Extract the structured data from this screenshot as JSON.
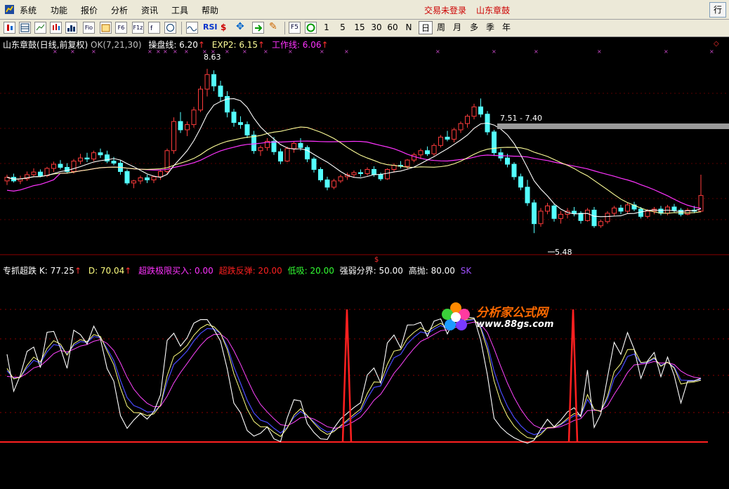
{
  "menu": [
    "系统",
    "功能",
    "报价",
    "分析",
    "资讯",
    "工具",
    "帮助"
  ],
  "status_links": {
    "trade": "交易未登录",
    "stock": "山东章鼓"
  },
  "row_button": "行",
  "toolbar": {
    "icons": [
      "Fio",
      "F10",
      "F6",
      "F1z",
      "RSI"
    ],
    "periods": [
      "1",
      "5",
      "15",
      "30",
      "60",
      "N"
    ],
    "scales": [
      "日",
      "周",
      "月",
      "多",
      "季",
      "年"
    ],
    "f5": "F5"
  },
  "main_header": {
    "name": "山东章鼓(日线,前复权)",
    "ok": "OK(7,21,30)",
    "ma1_label": "操盘线: 6.20",
    "ma2_label": "EXP2: 6.15",
    "ma3_label": "工作线: 6.06"
  },
  "annotations": {
    "high": "8.63",
    "mid": "7.51 - 7.40",
    "low": "5.48"
  },
  "indicator": {
    "name": "专抓超跌",
    "k": "K: 77.25",
    "d": "D: 70.04",
    "oversold": "超跌极限买入: 0.00",
    "rebound": "超跌反弹: 20.00",
    "low": "低吸: 20.00",
    "strong": "强弱分界: 50.00",
    "high": "高抛: 80.00",
    "sk": "SK"
  },
  "watermark": {
    "title": "分析家公式网",
    "url": "www.88gs.com"
  },
  "colors": {
    "up": "#ff3b3b",
    "down": "#54ffff",
    "ma1": "#ffffff",
    "ma2": "#ffff99",
    "ma3": "#ff33ff",
    "k": "#ffffff",
    "d": "#ffff80",
    "j": "#5050ff",
    "signal": "#ff2020"
  },
  "chart_data": {
    "type": "candlestick",
    "price_range": [
      5.2,
      8.9
    ],
    "candles": [
      [
        6.48,
        6.6,
        6.4,
        6.55
      ],
      [
        6.55,
        6.62,
        6.45,
        6.48
      ],
      [
        6.48,
        6.58,
        6.42,
        6.52
      ],
      [
        6.52,
        6.66,
        6.48,
        6.6
      ],
      [
        6.6,
        6.72,
        6.55,
        6.65
      ],
      [
        6.65,
        6.7,
        6.55,
        6.58
      ],
      [
        6.58,
        6.75,
        6.55,
        6.72
      ],
      [
        6.72,
        6.85,
        6.65,
        6.8
      ],
      [
        6.8,
        6.88,
        6.7,
        6.74
      ],
      [
        6.74,
        6.82,
        6.62,
        6.66
      ],
      [
        6.66,
        6.9,
        6.62,
        6.86
      ],
      [
        6.86,
        7.0,
        6.8,
        6.92
      ],
      [
        6.92,
        7.02,
        6.84,
        6.9
      ],
      [
        6.9,
        7.06,
        6.86,
        7.02
      ],
      [
        7.02,
        7.1,
        6.92,
        6.98
      ],
      [
        6.98,
        7.06,
        6.82,
        6.86
      ],
      [
        6.86,
        6.94,
        6.78,
        6.82
      ],
      [
        6.82,
        6.88,
        6.6,
        6.66
      ],
      [
        6.66,
        6.7,
        6.4,
        6.44
      ],
      [
        6.44,
        6.5,
        6.34,
        6.48
      ],
      [
        6.48,
        6.58,
        6.42,
        6.54
      ],
      [
        6.54,
        6.6,
        6.44,
        6.5
      ],
      [
        6.5,
        6.58,
        6.44,
        6.56
      ],
      [
        6.56,
        6.7,
        6.5,
        6.66
      ],
      [
        6.66,
        7.1,
        6.6,
        7.06
      ],
      [
        7.06,
        7.7,
        7.0,
        7.62
      ],
      [
        7.62,
        7.8,
        7.4,
        7.46
      ],
      [
        7.46,
        7.62,
        7.34,
        7.56
      ],
      [
        7.56,
        7.9,
        7.5,
        7.84
      ],
      [
        7.84,
        8.3,
        7.8,
        8.24
      ],
      [
        8.24,
        8.63,
        8.1,
        8.52
      ],
      [
        8.52,
        8.6,
        8.2,
        8.3
      ],
      [
        8.3,
        8.4,
        8.0,
        8.1
      ],
      [
        8.1,
        8.2,
        7.7,
        7.8
      ],
      [
        7.8,
        7.86,
        7.52,
        7.6
      ],
      [
        7.6,
        7.72,
        7.48,
        7.56
      ],
      [
        7.56,
        7.62,
        7.3,
        7.36
      ],
      [
        7.36,
        7.44,
        7.0,
        7.06
      ],
      [
        7.06,
        7.16,
        6.96,
        7.12
      ],
      [
        7.12,
        7.3,
        7.06,
        7.24
      ],
      [
        7.24,
        7.32,
        6.98,
        7.04
      ],
      [
        7.04,
        7.1,
        6.8,
        6.86
      ],
      [
        6.86,
        7.14,
        6.84,
        7.1
      ],
      [
        7.1,
        7.24,
        7.02,
        7.2
      ],
      [
        7.2,
        7.3,
        7.06,
        7.12
      ],
      [
        7.12,
        7.16,
        6.84,
        6.9
      ],
      [
        6.9,
        6.94,
        6.64,
        6.7
      ],
      [
        6.7,
        6.74,
        6.46,
        6.5
      ],
      [
        6.5,
        6.56,
        6.3,
        6.36
      ],
      [
        6.36,
        6.52,
        6.32,
        6.48
      ],
      [
        6.48,
        6.6,
        6.44,
        6.56
      ],
      [
        6.56,
        6.64,
        6.5,
        6.6
      ],
      [
        6.6,
        6.68,
        6.54,
        6.64
      ],
      [
        6.64,
        6.7,
        6.56,
        6.62
      ],
      [
        6.62,
        6.74,
        6.58,
        6.7
      ],
      [
        6.7,
        6.76,
        6.56,
        6.6
      ],
      [
        6.6,
        6.64,
        6.48,
        6.52
      ],
      [
        6.52,
        6.72,
        6.5,
        6.7
      ],
      [
        6.7,
        6.82,
        6.64,
        6.78
      ],
      [
        6.78,
        6.86,
        6.72,
        6.76
      ],
      [
        6.76,
        6.9,
        6.7,
        6.88
      ],
      [
        6.88,
        7.02,
        6.84,
        6.98
      ],
      [
        6.98,
        7.1,
        6.9,
        7.06
      ],
      [
        7.06,
        7.14,
        6.96,
        7.0
      ],
      [
        7.0,
        7.2,
        6.96,
        7.16
      ],
      [
        7.16,
        7.36,
        7.12,
        7.32
      ],
      [
        7.32,
        7.44,
        7.24,
        7.28
      ],
      [
        7.28,
        7.5,
        7.22,
        7.46
      ],
      [
        7.46,
        7.62,
        7.4,
        7.58
      ],
      [
        7.58,
        7.76,
        7.5,
        7.72
      ],
      [
        7.72,
        7.96,
        7.66,
        7.9
      ],
      [
        7.9,
        8.06,
        7.7,
        7.76
      ],
      [
        7.76,
        7.82,
        7.36,
        7.42
      ],
      [
        7.42,
        7.46,
        6.96,
        7.02
      ],
      [
        7.02,
        7.1,
        6.86,
        6.92
      ],
      [
        6.92,
        7.0,
        6.74,
        6.8
      ],
      [
        6.8,
        6.84,
        6.5,
        6.56
      ],
      [
        6.56,
        6.62,
        6.3,
        6.36
      ],
      [
        6.36,
        6.5,
        6.0,
        6.06
      ],
      [
        6.06,
        6.12,
        5.48,
        5.66
      ],
      [
        5.66,
        5.96,
        5.6,
        5.9
      ],
      [
        5.9,
        6.06,
        5.84,
        6.0
      ],
      [
        6.0,
        6.04,
        5.7,
        5.76
      ],
      [
        5.76,
        5.9,
        5.66,
        5.84
      ],
      [
        5.84,
        5.96,
        5.76,
        5.9
      ],
      [
        5.9,
        5.98,
        5.8,
        5.86
      ],
      [
        5.86,
        5.9,
        5.66,
        5.72
      ],
      [
        5.72,
        5.96,
        5.7,
        5.92
      ],
      [
        5.92,
        5.98,
        5.58,
        5.62
      ],
      [
        5.62,
        5.74,
        5.58,
        5.7
      ],
      [
        5.7,
        5.9,
        5.66,
        5.86
      ],
      [
        5.86,
        6.0,
        5.8,
        5.96
      ],
      [
        5.96,
        6.02,
        5.84,
        5.9
      ],
      [
        5.9,
        6.06,
        5.86,
        6.02
      ],
      [
        6.02,
        6.08,
        5.9,
        5.94
      ],
      [
        5.94,
        5.98,
        5.76,
        5.8
      ],
      [
        5.8,
        5.94,
        5.76,
        5.9
      ],
      [
        5.9,
        5.98,
        5.84,
        5.94
      ],
      [
        5.94,
        6.0,
        5.82,
        5.86
      ],
      [
        5.86,
        6.02,
        5.82,
        5.98
      ],
      [
        5.98,
        6.04,
        5.88,
        5.92
      ],
      [
        5.92,
        5.96,
        5.8,
        5.84
      ],
      [
        5.84,
        5.96,
        5.82,
        5.92
      ],
      [
        5.92,
        6.0,
        5.86,
        5.9
      ],
      [
        5.9,
        6.6,
        5.88,
        6.2
      ]
    ]
  }
}
